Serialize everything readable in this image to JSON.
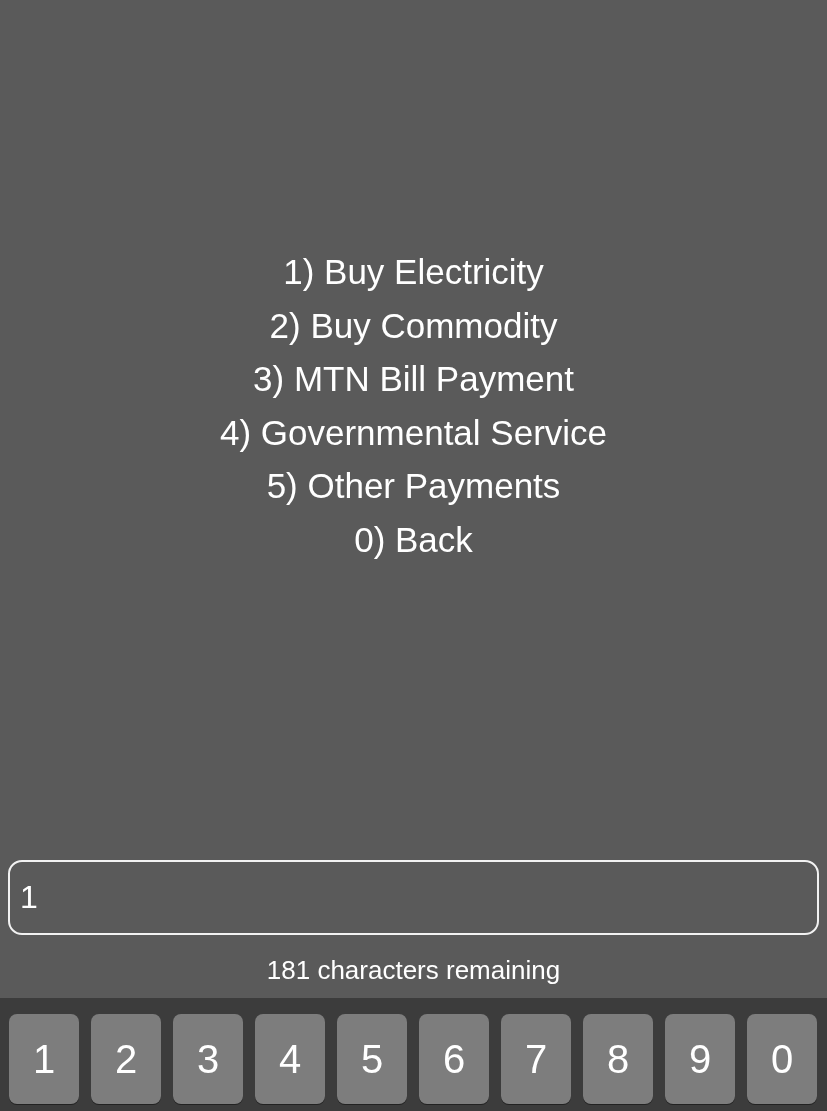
{
  "menu": {
    "lines": [
      "1) Buy Electricity",
      "2) Buy Commodity",
      "3) MTN Bill Payment",
      "4) Governmental Service",
      "5) Other Payments",
      "0) Back"
    ]
  },
  "reply": {
    "value": "1",
    "counter": "181 characters remaining"
  },
  "keypad": {
    "keys": [
      "1",
      "2",
      "3",
      "4",
      "5",
      "6",
      "7",
      "8",
      "9",
      "0"
    ]
  }
}
